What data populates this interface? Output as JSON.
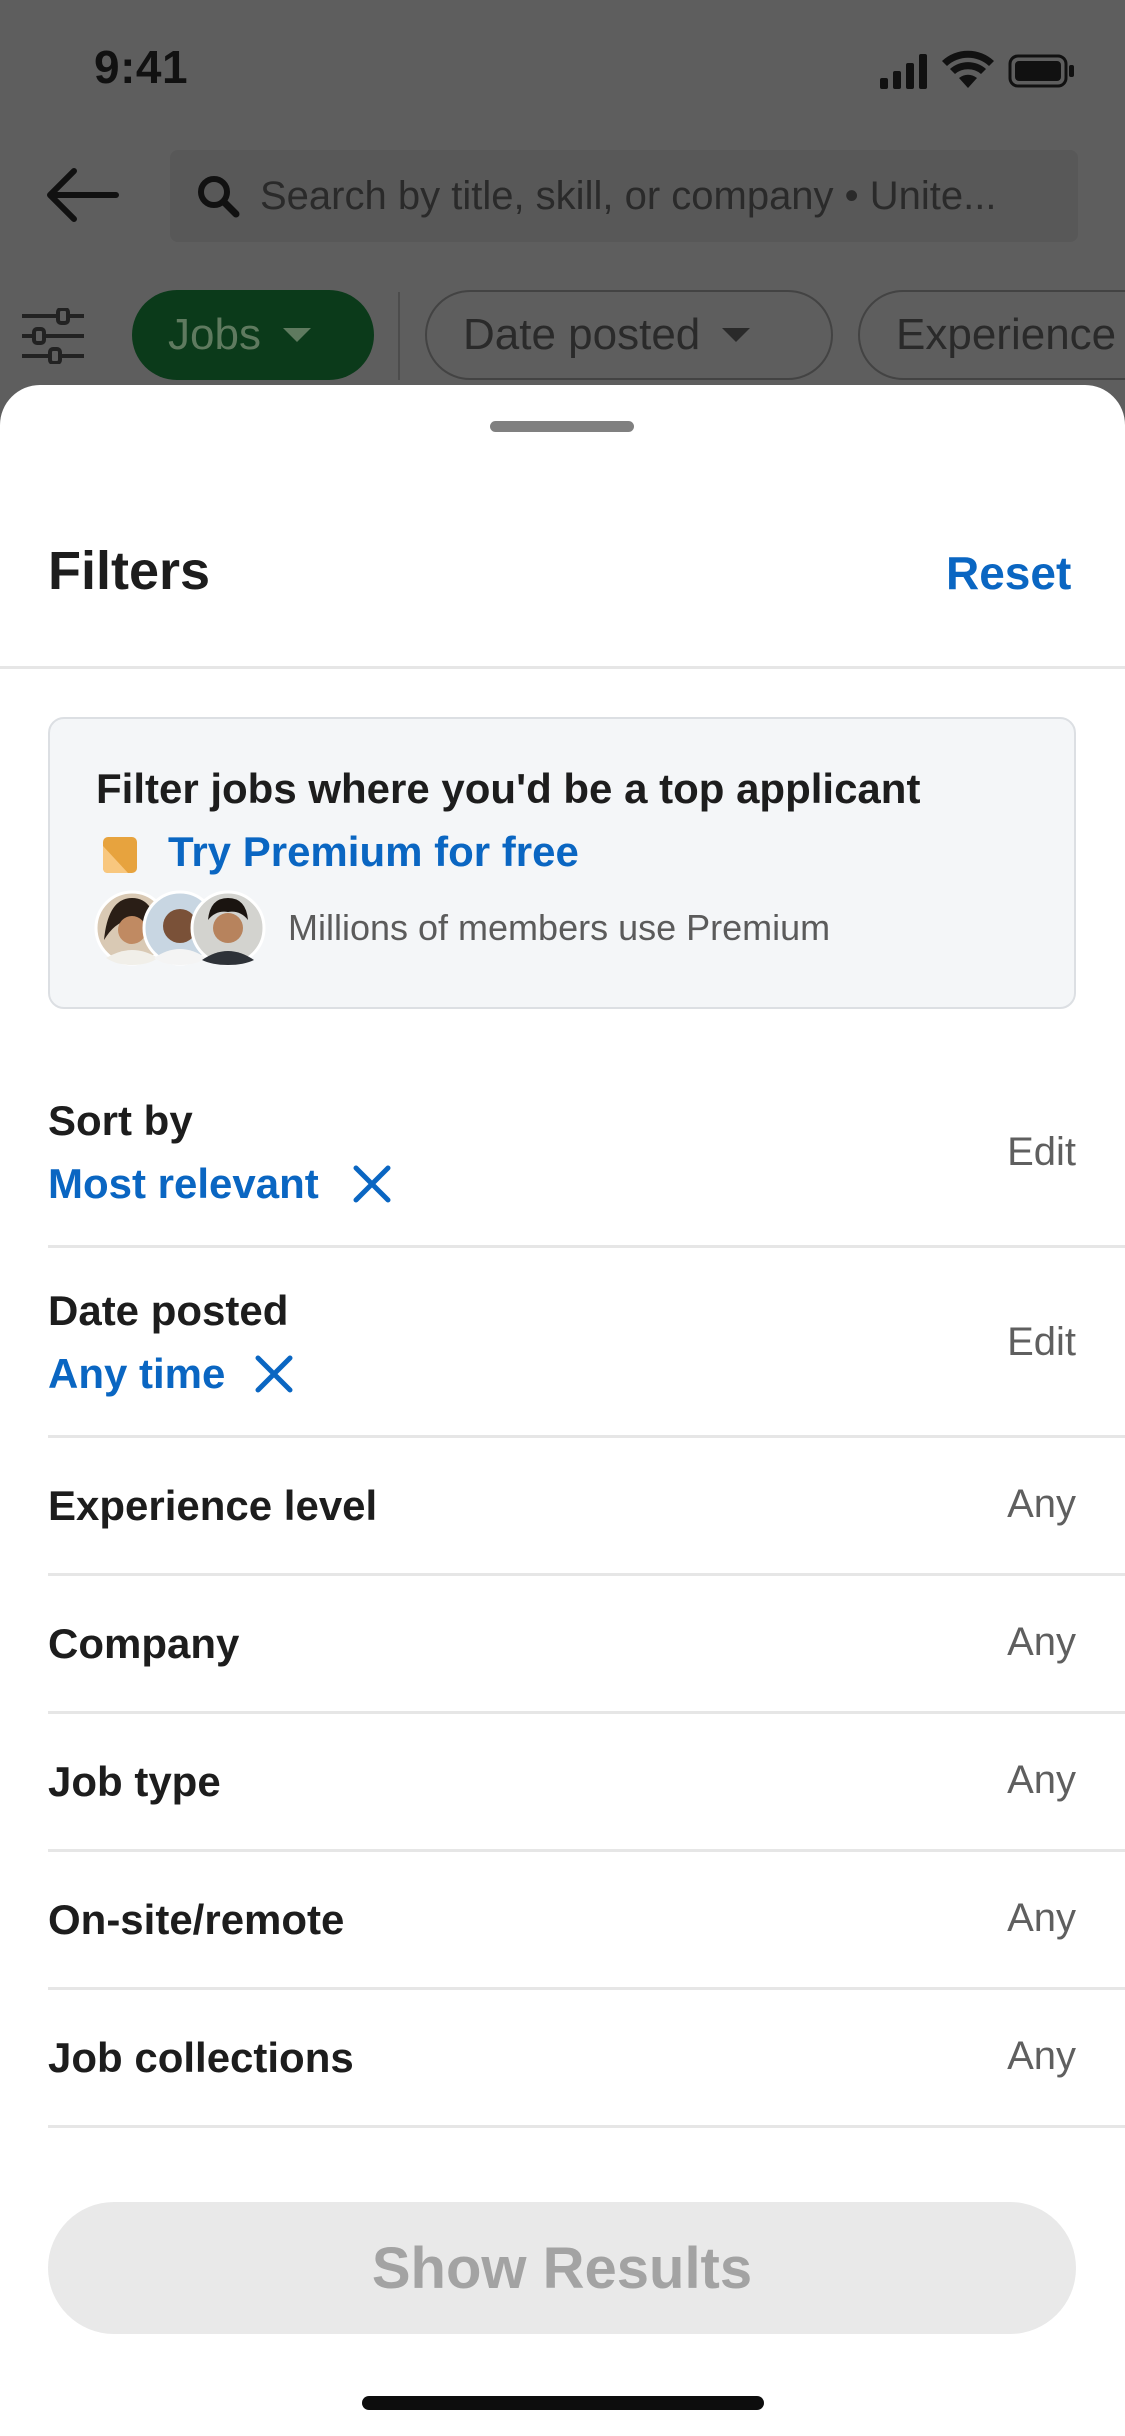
{
  "status_bar": {
    "time": "9:41"
  },
  "search": {
    "placeholder": "Search by title, skill, or company • Unite..."
  },
  "chips": {
    "jobs": "Jobs",
    "date_posted": "Date posted",
    "experience": "Experience"
  },
  "sheet": {
    "title": "Filters",
    "reset_label": "Reset"
  },
  "premium": {
    "headline": "Filter jobs where you'd be a top applicant",
    "link": "Try Premium for free",
    "caption": "Millions of members use Premium"
  },
  "filters": [
    {
      "label": "Sort by",
      "value": "Most relevant",
      "action": "Edit"
    },
    {
      "label": "Date posted",
      "value": "Any time",
      "action": "Edit"
    },
    {
      "label": "Experience level",
      "action": "Any"
    },
    {
      "label": "Company",
      "action": "Any"
    },
    {
      "label": "Job type",
      "action": "Any"
    },
    {
      "label": "On-site/remote",
      "action": "Any"
    },
    {
      "label": "Job collections",
      "action": "Any"
    }
  ],
  "footer": {
    "show_results_label": "Show Results"
  },
  "colors": {
    "accent": "#0a66c2",
    "jobs_chip": "#0b3a1a",
    "disabled_button": "#e9e9e9"
  }
}
